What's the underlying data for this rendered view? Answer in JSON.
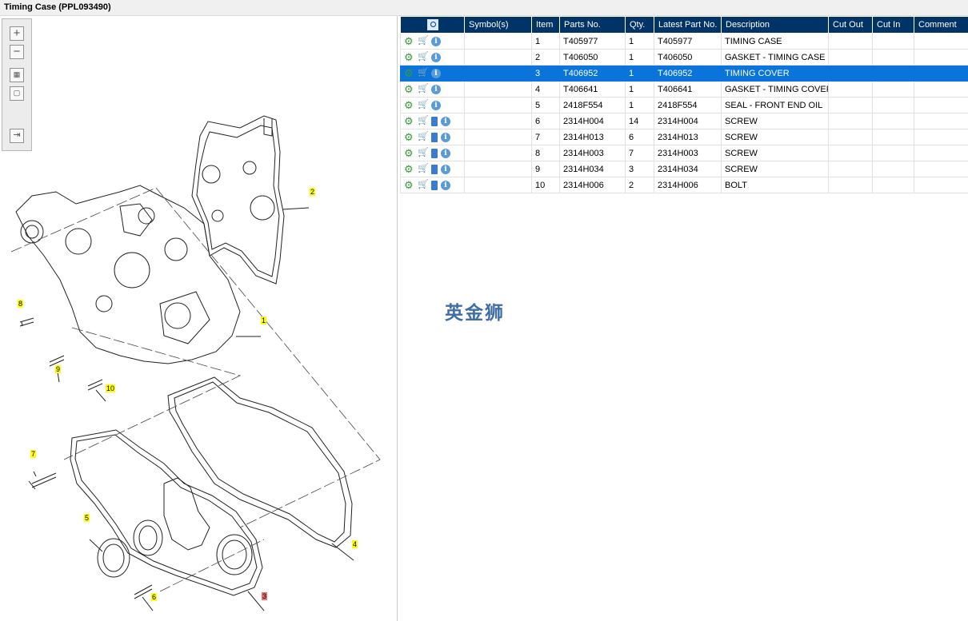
{
  "window": {
    "title": "Timing Case (PPL093490)"
  },
  "colors": {
    "header_bg": "#003366",
    "selected_row": "#0a74da",
    "callout": "#ffff00",
    "callout_selected": "#f07070"
  },
  "toolbox": {
    "icons": [
      "zoom-in-icon",
      "zoom-out-icon",
      "fit-icon",
      "actual-size-icon",
      "panel-toggle-icon"
    ]
  },
  "table": {
    "headers": [
      "",
      "Symbol(s)",
      "Item",
      "Parts No.",
      "Qty.",
      "Latest Part No.",
      "Description",
      "Cut Out",
      "Cut In",
      "Comment"
    ],
    "rows": [
      {
        "item": "1",
        "part": "T405977",
        "qty": "1",
        "latest": "T405977",
        "desc": "TIMING CASE",
        "doc": false,
        "selected": false
      },
      {
        "item": "2",
        "part": "T406050",
        "qty": "1",
        "latest": "T406050",
        "desc": "GASKET - TIMING CASE",
        "doc": false,
        "selected": false
      },
      {
        "item": "3",
        "part": "T406952",
        "qty": "1",
        "latest": "T406952",
        "desc": "TIMING COVER",
        "doc": false,
        "selected": true
      },
      {
        "item": "4",
        "part": "T406641",
        "qty": "1",
        "latest": "T406641",
        "desc": "GASKET - TIMING COVER",
        "doc": false,
        "selected": false
      },
      {
        "item": "5",
        "part": "2418F554",
        "qty": "1",
        "latest": "2418F554",
        "desc": "SEAL - FRONT END OIL",
        "doc": false,
        "selected": false
      },
      {
        "item": "6",
        "part": "2314H004",
        "qty": "14",
        "latest": "2314H004",
        "desc": "SCREW",
        "doc": true,
        "selected": false
      },
      {
        "item": "7",
        "part": "2314H013",
        "qty": "6",
        "latest": "2314H013",
        "desc": "SCREW",
        "doc": true,
        "selected": false
      },
      {
        "item": "8",
        "part": "2314H003",
        "qty": "7",
        "latest": "2314H003",
        "desc": "SCREW",
        "doc": true,
        "selected": false
      },
      {
        "item": "9",
        "part": "2314H034",
        "qty": "3",
        "latest": "2314H034",
        "desc": "SCREW",
        "doc": true,
        "selected": false
      },
      {
        "item": "10",
        "part": "2314H006",
        "qty": "2",
        "latest": "2314H006",
        "desc": "BOLT",
        "doc": true,
        "selected": false
      }
    ]
  },
  "callouts": [
    "1",
    "2",
    "3",
    "4",
    "5",
    "6",
    "7",
    "8",
    "9",
    "10"
  ],
  "watermark": "英金狮"
}
